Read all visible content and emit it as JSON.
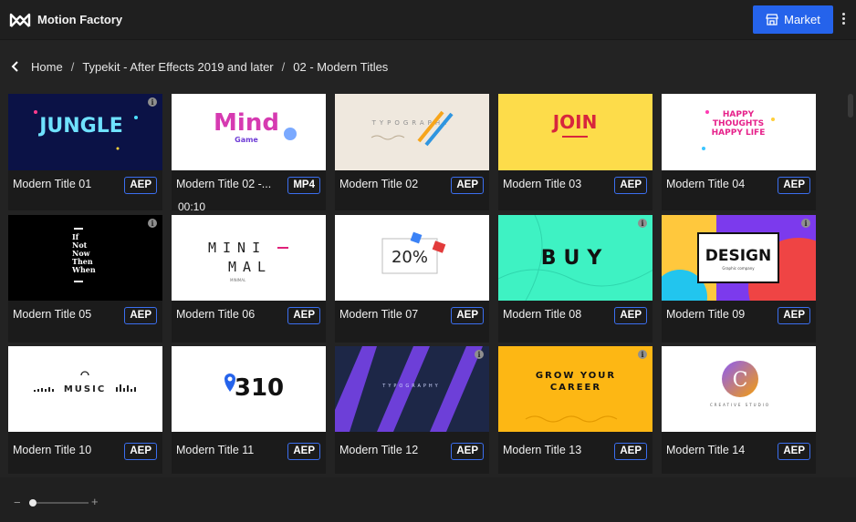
{
  "app": {
    "title": "Motion Factory",
    "logo_icon": "motion-factory-logo"
  },
  "header": {
    "market_label": "Market",
    "market_icon": "storefront-icon",
    "accent": "#2563eb"
  },
  "breadcrumb": {
    "items": [
      "Home",
      "Typekit - After Effects 2019 and later",
      "02 - Modern Titles"
    ],
    "separator": "/"
  },
  "items": [
    {
      "title": "Modern Title 01",
      "format": "AEP",
      "thumb_text": "JUNGLE"
    },
    {
      "title": "Modern Title 02 -...",
      "format": "MP4",
      "duration": "00:10",
      "thumb_text": "Mind",
      "thumb_sub": "Game"
    },
    {
      "title": "Modern Title 02",
      "format": "AEP",
      "thumb_text": "TYPOGRAPHY"
    },
    {
      "title": "Modern Title 03",
      "format": "AEP",
      "thumb_text": "JOIN"
    },
    {
      "title": "Modern Title 04",
      "format": "AEP",
      "thumb_text": "HAPPY THOUGHTS HAPPY LIFE"
    },
    {
      "title": "Modern Title 05",
      "format": "AEP",
      "thumb_text": "If Not Now Then When"
    },
    {
      "title": "Modern Title 06",
      "format": "AEP",
      "thumb_text": "MINIMAL"
    },
    {
      "title": "Modern Title 07",
      "format": "AEP",
      "thumb_text": "20%"
    },
    {
      "title": "Modern Title 08",
      "format": "AEP",
      "thumb_text": "BUY"
    },
    {
      "title": "Modern Title 09",
      "format": "AEP",
      "thumb_text": "DESIGN",
      "thumb_sub": "Graphic company"
    },
    {
      "title": "Modern Title 10",
      "format": "AEP",
      "thumb_text": "MUSIC"
    },
    {
      "title": "Modern Title 11",
      "format": "AEP",
      "thumb_text": "310"
    },
    {
      "title": "Modern Title 12",
      "format": "AEP",
      "thumb_text": "TYPOGRAPHY"
    },
    {
      "title": "Modern Title 13",
      "format": "AEP",
      "thumb_text": "GROW YOUR CAREER"
    },
    {
      "title": "Modern Title 14",
      "format": "AEP",
      "thumb_text": "C",
      "thumb_sub": "CREATIVE STUDIO"
    }
  ],
  "zoom": {
    "minus": "−",
    "plus": "+",
    "level": 0.05
  }
}
